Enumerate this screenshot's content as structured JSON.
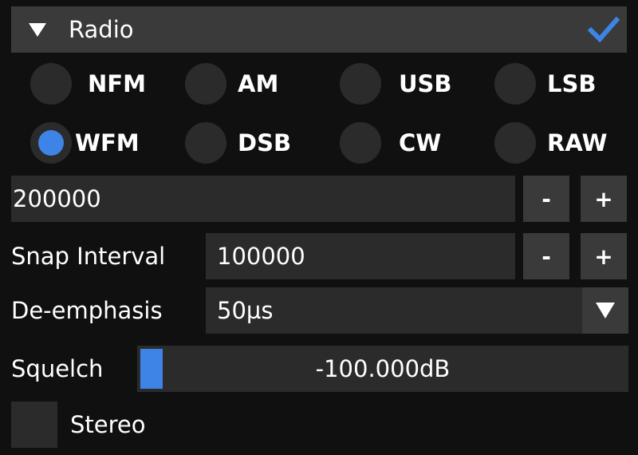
{
  "header": {
    "title": "Radio"
  },
  "enable": {
    "checked": true,
    "icon": "checkmark-icon",
    "accent": "#3d84e6"
  },
  "demod": {
    "modes": [
      {
        "label": "NFM",
        "selected": false
      },
      {
        "label": "AM",
        "selected": false
      },
      {
        "label": "USB",
        "selected": false
      },
      {
        "label": "LSB",
        "selected": false
      },
      {
        "label": "WFM",
        "selected": true
      },
      {
        "label": "DSB",
        "selected": false
      },
      {
        "label": "CW",
        "selected": false
      },
      {
        "label": "RAW",
        "selected": false
      }
    ]
  },
  "bandwidth": {
    "value": "200000",
    "minus": "-",
    "plus": "+"
  },
  "snap": {
    "label": "Snap Interval",
    "value": "100000",
    "minus": "-",
    "plus": "+"
  },
  "deemphasis": {
    "label": "De-emphasis",
    "value": "50µs"
  },
  "squelch": {
    "label": "Squelch",
    "value_text": "-100.000dB",
    "level": 0.0
  },
  "stereo": {
    "label": "Stereo",
    "checked": false
  },
  "colors": {
    "panel_bg": "#101010",
    "header_bg": "#3a3a3a",
    "field_bg": "#2b2b2b",
    "accent": "#3d84e6"
  }
}
